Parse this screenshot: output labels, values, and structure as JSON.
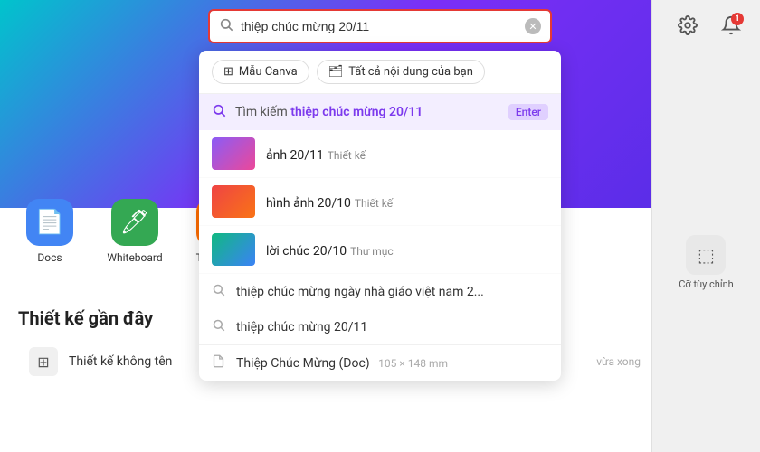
{
  "header": {
    "search_value": "thiệp chúc mừng 20/11",
    "search_placeholder": "Tìm kiếm thiệp chúc mừng 20/11"
  },
  "dropdown": {
    "tab1_label": "Mẫu Canva",
    "tab2_label": "Tất cả nội dung của bạn",
    "suggestion_prefix": "Tìm kiếm ",
    "suggestion_query": "thiệp chúc mừng 20/11",
    "suggestion_enter": "Enter",
    "results": [
      {
        "name": "ảnh 20/11",
        "type": "Thiết kế",
        "thumb": "1"
      },
      {
        "name": "hình ảnh 20/10",
        "type": "Thiết kế",
        "thumb": "2"
      },
      {
        "name": "lời chúc 20/10",
        "type": "Thư mục",
        "thumb": "3"
      }
    ],
    "text_suggestions": [
      "thiệp chúc mừng ngày nhà giáo việt nam 2...",
      "thiệp chúc mừng 20/11"
    ],
    "last_item_name": "Thiệp Chúc Mừng (Doc)",
    "last_item_size": "105 × 148 mm"
  },
  "quick_icons": [
    {
      "label": "Docs",
      "color": "docs-color",
      "icon": "📄"
    },
    {
      "label": "Whiteboard",
      "color": "whiteboard-color",
      "icon": "🖊"
    },
    {
      "label": "Thuyết t...",
      "color": "present-color",
      "icon": "👁"
    }
  ],
  "recent_section": {
    "title": "Thiết kế gần đây",
    "item_label": "Thiết kế không tên",
    "item_badge": "vừa xong"
  },
  "right_panel": {
    "icon_label": "Cỡ tùy chỉnh"
  }
}
